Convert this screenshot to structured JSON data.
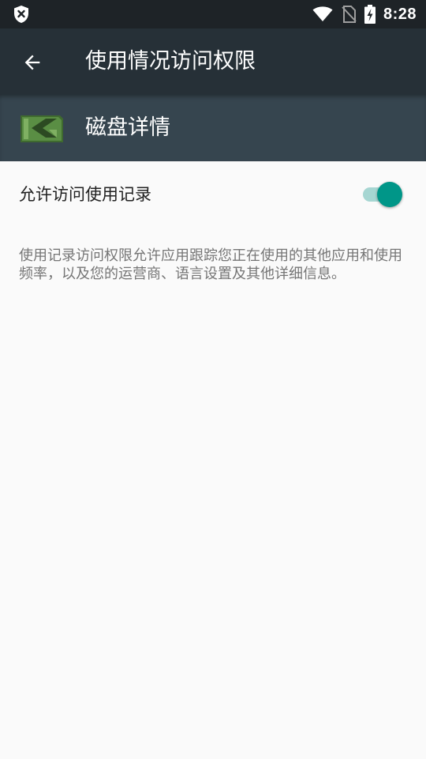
{
  "status_bar": {
    "time": "8:28",
    "icons": [
      "shield-x-icon",
      "wifi-icon",
      "no-sim-icon",
      "battery-charging-icon"
    ]
  },
  "app_bar": {
    "title": "使用情况访问权限",
    "back_icon": "arrow-left-icon"
  },
  "app_header": {
    "name": "磁盘详情",
    "icon": "disk-app-icon"
  },
  "setting": {
    "label": "允许访问使用记录",
    "enabled": true
  },
  "description": "使用记录访问权限允许应用跟踪您正在使用的其他应用和使用频率，以及您的运营商、语言设置及其他详细信息。",
  "colors": {
    "status_bar": "#1e2327",
    "app_bar": "#263037",
    "app_header": "#36454f",
    "background": "#fafafa",
    "accent": "#009688",
    "accent_track": "#a6d6d2"
  }
}
